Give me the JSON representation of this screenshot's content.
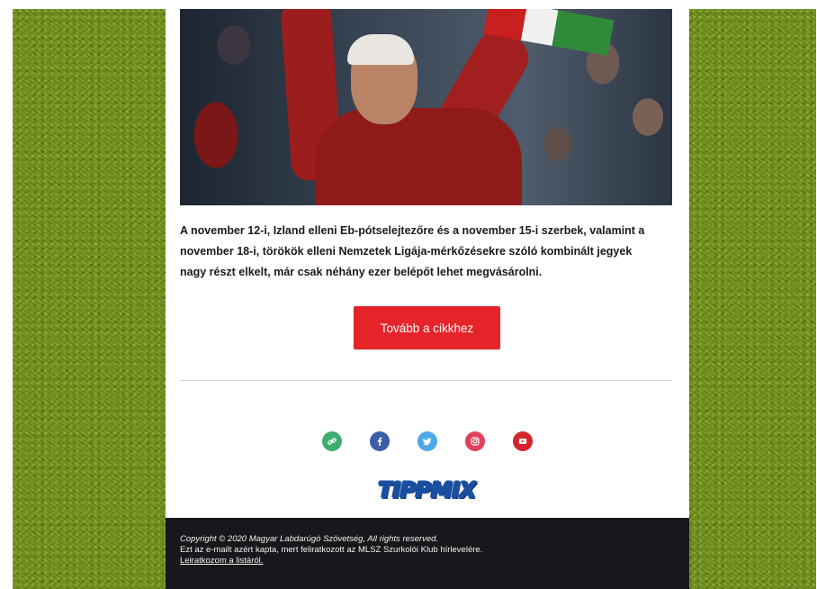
{
  "article": {
    "text": "A november 12-i, Izland elleni Eb-pótselejtezőre és a november 15-i szerbek, valamint a november 18-i, törökök elleni Nemzetek Ligája-mérkőzésekre szóló kombinált jegyek nagy részt elkelt, már csak néhány ezer belépőt lehet megvásárolni."
  },
  "cta": {
    "label": "Tovább a cikkhez",
    "color": "#e5242a"
  },
  "social": [
    {
      "name": "link-icon",
      "color": "#3dae6f"
    },
    {
      "name": "facebook-icon",
      "color": "#3b5ea8"
    },
    {
      "name": "twitter-icon",
      "color": "#4aa9e6"
    },
    {
      "name": "instagram-icon",
      "color": "#e2415d"
    },
    {
      "name": "youtube-icon",
      "color": "#d3252b"
    }
  ],
  "logo": {
    "text": "TIPPMIX"
  },
  "footer": {
    "copyright": "Copyright © 2020 Magyar Labdarúgó Szövetség, All rights reserved.",
    "reason": "Ezt az e-mailt azért kapta, mert feliratkozott az MLSZ Szurkolói Klub hírlevelére.",
    "unsubscribe": "Leiratkozom a listáról."
  },
  "colors": {
    "grass": "#6e8f1e",
    "footer_bg": "#17181b",
    "divider": "#d9d9d9"
  }
}
